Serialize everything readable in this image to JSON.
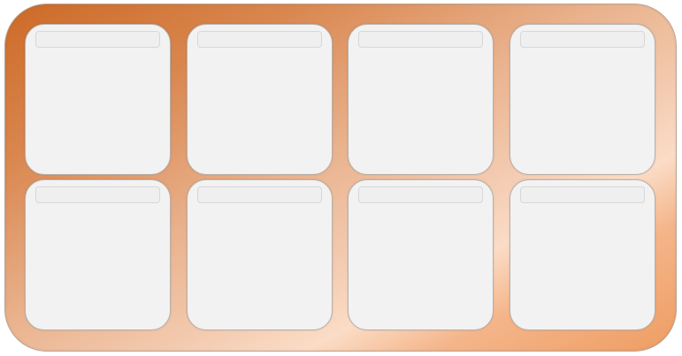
{
  "tiles": [
    {
      "title": ""
    },
    {
      "title": ""
    },
    {
      "title": ""
    },
    {
      "title": ""
    },
    {
      "title": ""
    },
    {
      "title": ""
    },
    {
      "title": ""
    },
    {
      "title": ""
    }
  ]
}
